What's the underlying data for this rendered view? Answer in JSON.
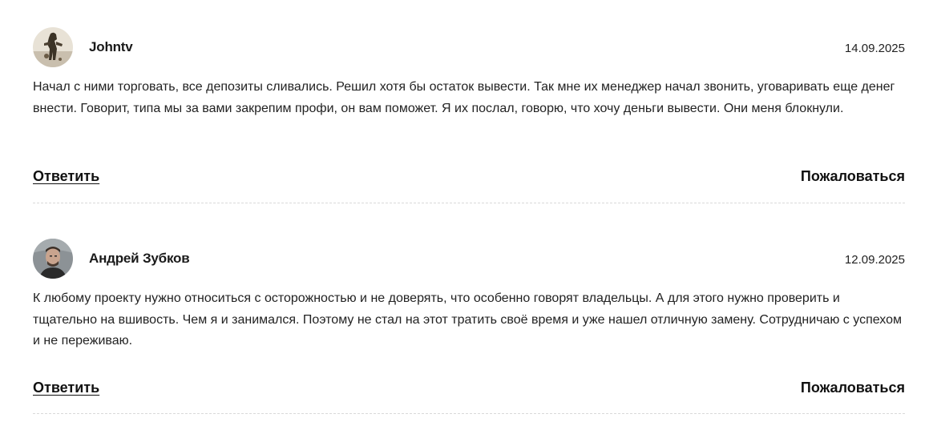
{
  "comments": [
    {
      "author": "Johntv",
      "date": "14.09.2025",
      "text": "Начал с ними торговать, все депозиты сливались. Решил хотя бы остаток вывести. Так мне их менеджер начал звонить, уговаривать еще денег внести. Говорит, типа мы за вами закрепим профи, он вам поможет. Я их послал, говорю, что хочу деньги вывести. Они меня блокнули.",
      "reply_label": "Ответить",
      "complain_label": "Пожаловаться"
    },
    {
      "author": "Андрей Зубков",
      "date": "12.09.2025",
      "text": "К любому проекту нужно относиться с осторожностью и не доверять, что особенно говорят владельцы. А для этого нужно проверить и тщательно на вшивость. Чем я и занимался. Поэтому не стал на этот тратить своё время и уже нашел отличную замену. Сотрудничаю с успехом и не переживаю.",
      "reply_label": "Ответить",
      "complain_label": "Пожаловаться"
    }
  ],
  "colors": {
    "text": "#1a1a1a",
    "divider": "#d9d9d9",
    "background": "#ffffff"
  }
}
